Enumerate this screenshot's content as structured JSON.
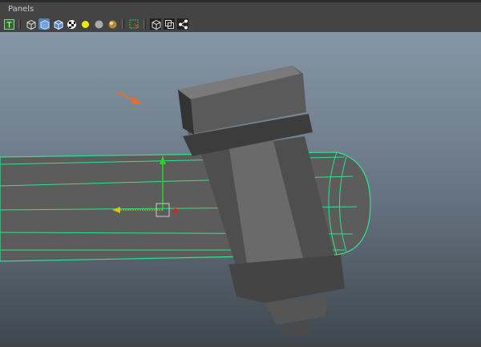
{
  "menu": {
    "panels": "Panels"
  },
  "toolbar": {
    "icons": [
      "text-icon",
      "wireframe-cube-icon",
      "smooth-shade-cube-icon",
      "textured-cube-icon",
      "checker-ball-icon",
      "light-ball-icon",
      "sphere-icon",
      "gold-sphere-icon",
      "select-cursor-icon",
      "cube-icon",
      "isolate-icon",
      "share-nodes-icon"
    ]
  },
  "colors": {
    "wire": "#2fe38a",
    "arrow": "#f26a1f",
    "mesh": "#5a5a5a"
  }
}
